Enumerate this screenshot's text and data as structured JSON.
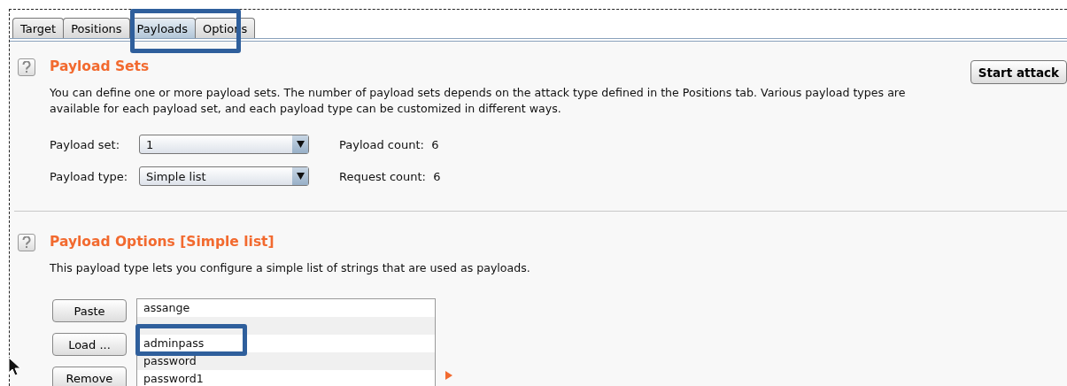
{
  "tabs": [
    {
      "label": "Target",
      "selected": false
    },
    {
      "label": "Positions",
      "selected": false
    },
    {
      "label": "Payloads",
      "selected": true
    },
    {
      "label": "Options",
      "selected": false
    }
  ],
  "start_button": "Start attack",
  "payload_sets": {
    "title": "Payload Sets",
    "description": "You can define one or more payload sets. The number of payload sets depends on the attack type defined in the Positions tab. Various payload types are available for each payload set, and each payload type can be customized in different ways.",
    "fields": [
      {
        "label": "Payload set:",
        "value": "1",
        "info_label": "Payload count:",
        "info_value": "6"
      },
      {
        "label": "Payload type:",
        "value": "Simple list",
        "info_label": "Request count:",
        "info_value": "6"
      }
    ]
  },
  "payload_options": {
    "title": "Payload Options [Simple list]",
    "description": "This payload type lets you configure a simple list of strings that are used as payloads.",
    "buttons": [
      "Paste",
      "Load ...",
      "Remove"
    ],
    "items": [
      {
        "kind": "text",
        "text": "assange"
      },
      {
        "kind": "covered"
      },
      {
        "kind": "text",
        "text": "adminpass"
      },
      {
        "kind": "text",
        "text": "password"
      },
      {
        "kind": "text",
        "text": "password1"
      }
    ]
  }
}
